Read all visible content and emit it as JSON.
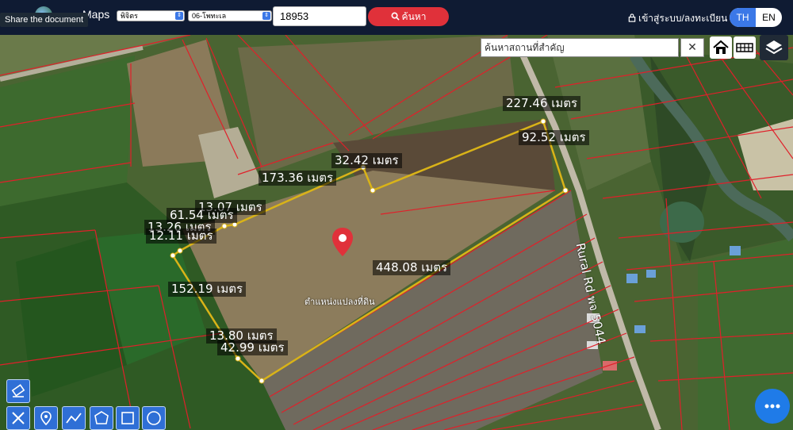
{
  "header": {
    "brand": "Maps",
    "tooltip": "Share the document",
    "province": "พิจิตร",
    "district": "06-โพทะเล",
    "parcel_number": "18953",
    "search_label": "ค้นหา",
    "login_label": "เข้าสู่ระบบ/ลงทะเบียน",
    "lang_th": "TH",
    "lang_en": "EN"
  },
  "map": {
    "place_search_placeholder": "ค้นหาสถานที่สำคัญ",
    "center_label": "ตำแหน่งแปลงที่ดิน",
    "road_label": "Rural Rd พจ 5044",
    "measurements": [
      "227.46 เมตร",
      "92.52 เมตร",
      "32.42 เมตร",
      "173.36 เมตร",
      "13.07 เมตร",
      "61.54 เมตร",
      "13.26 เมตร",
      "12.11 เมตร",
      "448.08 เมตร",
      "152.19 เมตร",
      "13.80 เมตร",
      "42.99 เมตร"
    ]
  },
  "colors": {
    "topbar": "#0f1b33",
    "accent_red": "#e0313a",
    "accent_blue": "#3b78e7",
    "parcel_outline": "#d9b318",
    "cadastral_lines": "#e0202a"
  },
  "icons": [
    "eraser-icon",
    "ruler-icon",
    "pin-icon",
    "line-icon",
    "polygon-icon",
    "rectangle-icon",
    "circle-icon",
    "home-icon",
    "grid-icon",
    "layers-icon",
    "close-icon",
    "more-icon",
    "lock-icon",
    "search-icon"
  ]
}
